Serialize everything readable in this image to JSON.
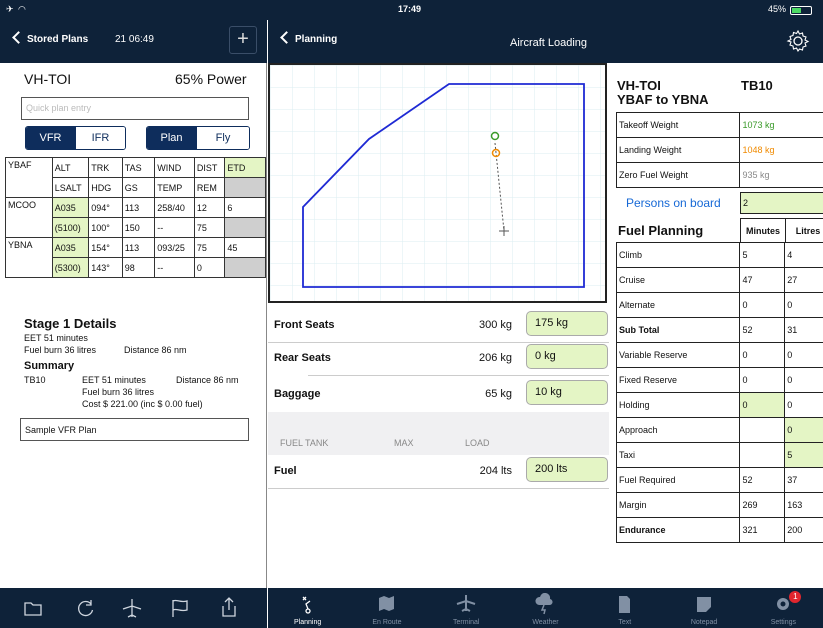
{
  "status": {
    "time": "17:49",
    "battery": "45%"
  },
  "left": {
    "back_label": "Stored Plans",
    "datetime": "21 06:49",
    "registration": "VH-TOI",
    "power": "65% Power",
    "quick_placeholder": "Quick plan entry",
    "rules": [
      "VFR",
      "IFR"
    ],
    "modes": [
      "Plan",
      "Fly"
    ],
    "nav_headers_top": [
      "ALT",
      "TRK",
      "TAS",
      "WIND",
      "DIST",
      "ETD"
    ],
    "nav_headers_bottom": [
      "LSALT",
      "HDG",
      "GS",
      "TEMP",
      "REM",
      ""
    ],
    "legs": [
      {
        "wpt": "YBAF",
        "top": [
          "ALT",
          "TRK",
          "TAS",
          "WIND",
          "DIST",
          "ETD"
        ],
        "bottom": [
          "LSALT",
          "HDG",
          "GS",
          "TEMP",
          "REM",
          ""
        ]
      },
      {
        "wpt": "MCOO",
        "top": [
          "A035",
          "094°",
          "113",
          "258/40",
          "12",
          "6"
        ],
        "bottom": [
          "(5100)",
          "100°",
          "150",
          "--",
          "75",
          ""
        ]
      },
      {
        "wpt": "YBNA",
        "top": [
          "A035",
          "154°",
          "113",
          "093/25",
          "75",
          "45"
        ],
        "bottom": [
          "(5300)",
          "143°",
          "98",
          "--",
          "0",
          ""
        ]
      }
    ],
    "stage_title": "Stage 1 Details",
    "stage_ete": "EET 51 minutes",
    "stage_fuel": "Fuel burn 36 litres",
    "stage_dist": "Distance 86 nm",
    "summary_title": "Summary",
    "summary_ac": "TB10",
    "summary_eet": "EET 51 minutes",
    "summary_dist": "Distance 86 nm",
    "summary_fuel": "Fuel burn 36 litres",
    "summary_cost": "Cost $ 221.00 (inc $ 0.00 fuel)",
    "remarks": "Sample VFR Plan"
  },
  "right": {
    "back_label": "Planning",
    "title": "Aircraft Loading",
    "loads": [
      {
        "name": "Front Seats",
        "max": "300 kg",
        "value": "175 kg"
      },
      {
        "name": "Rear Seats",
        "max": "206 kg",
        "value": "0 kg"
      },
      {
        "name": "Baggage",
        "max": "65 kg",
        "value": "10 kg"
      }
    ],
    "fuel_headers": [
      "FUEL TANK",
      "MAX",
      "LOAD"
    ],
    "fuel": {
      "name": "Fuel",
      "max": "204 lts",
      "value": "200 lts"
    },
    "wb": {
      "registration": "VH-TOI",
      "route": "YBAF to YBNA",
      "type": "TB10",
      "weights": [
        {
          "label": "Takeoff Weight",
          "value": "1073 kg",
          "color": "#3a9a2a"
        },
        {
          "label": "Landing Weight",
          "value": "1048 kg",
          "color": "#f08a00"
        },
        {
          "label": "Zero Fuel Weight",
          "value": "935 kg",
          "color": "#888888"
        }
      ],
      "pob_label": "Persons on board",
      "pob_value": "2",
      "fuel_title": "Fuel Planning",
      "fuel_cols": [
        "Minutes",
        "Litres"
      ],
      "fuel_rows": [
        {
          "label": "Climb",
          "min": "5",
          "lit": "4",
          "bold": false,
          "gmin": false,
          "glit": false
        },
        {
          "label": "Cruise",
          "min": "47",
          "lit": "27",
          "bold": false,
          "gmin": false,
          "glit": false
        },
        {
          "label": "Alternate",
          "min": "0",
          "lit": "0",
          "bold": false,
          "gmin": false,
          "glit": false
        },
        {
          "label": "Sub Total",
          "min": "52",
          "lit": "31",
          "bold": true,
          "gmin": false,
          "glit": false
        },
        {
          "label": "Variable Reserve",
          "min": "0",
          "lit": "0",
          "bold": false,
          "gmin": false,
          "glit": false
        },
        {
          "label": "Fixed Reserve",
          "min": "0",
          "lit": "0",
          "bold": false,
          "gmin": false,
          "glit": false
        },
        {
          "label": "Holding",
          "min": "0",
          "lit": "0",
          "bold": false,
          "gmin": true,
          "glit": false
        },
        {
          "label": "Approach",
          "min": "",
          "lit": "0",
          "bold": false,
          "gmin": false,
          "glit": true
        },
        {
          "label": "Taxi",
          "min": "",
          "lit": "5",
          "bold": false,
          "gmin": false,
          "glit": true
        },
        {
          "label": "Fuel Required",
          "min": "52",
          "lit": "37",
          "bold": false,
          "gmin": false,
          "glit": false
        },
        {
          "label": "Margin",
          "min": "269",
          "lit": "163",
          "bold": false,
          "gmin": false,
          "glit": false
        },
        {
          "label": "Endurance",
          "min": "321",
          "lit": "200",
          "bold": true,
          "gmin": false,
          "glit": false
        }
      ]
    }
  },
  "tabs": [
    {
      "label": "Planning",
      "icon": "route-icon",
      "active": true
    },
    {
      "label": "En Route",
      "icon": "map-icon",
      "active": false
    },
    {
      "label": "Terminal",
      "icon": "plane-icon",
      "active": false
    },
    {
      "label": "Weather",
      "icon": "weather-icon",
      "active": false
    },
    {
      "label": "Text",
      "icon": "text-icon",
      "active": false
    },
    {
      "label": "Notepad",
      "icon": "notepad-icon",
      "active": false
    },
    {
      "label": "Settings",
      "icon": "settings-icon",
      "active": false,
      "badge": "1"
    }
  ],
  "colors": {
    "nav": "#0e2239",
    "envelope": "#1f2ad4",
    "accent_green": "#e4f5c5",
    "segment": "#0e2d5c"
  }
}
